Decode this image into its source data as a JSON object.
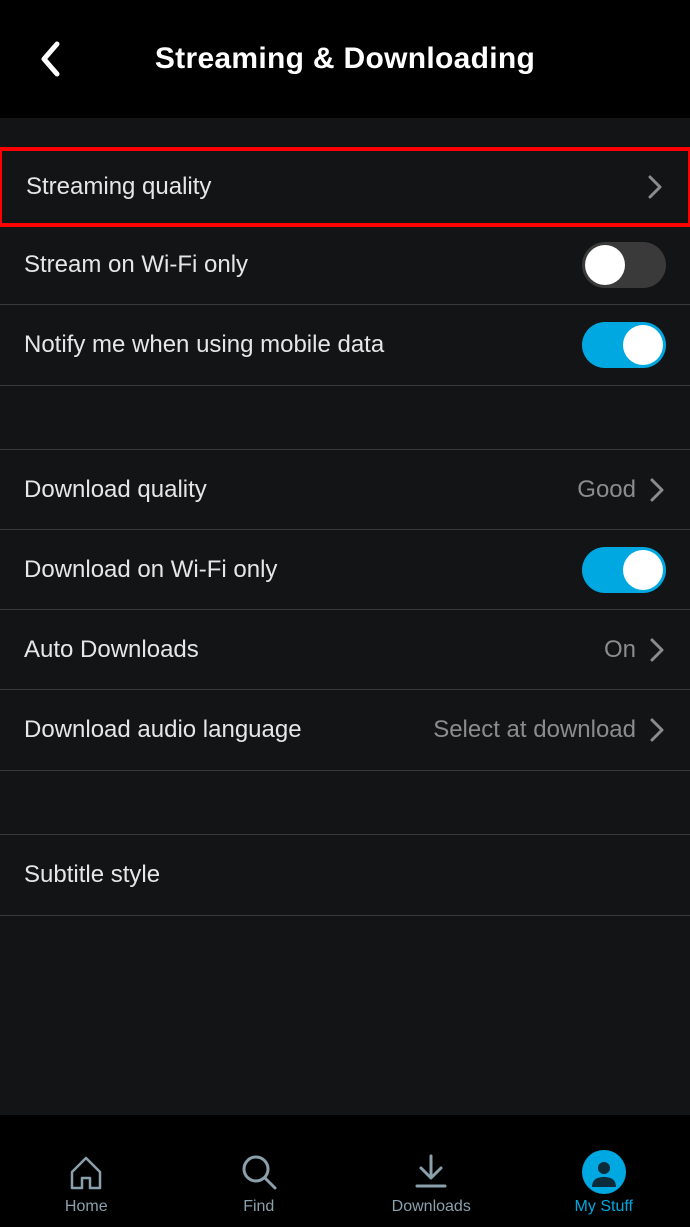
{
  "header": {
    "title": "Streaming & Downloading"
  },
  "sections": {
    "streaming": {
      "quality": {
        "label": "Streaming quality"
      },
      "wifi_only": {
        "label": "Stream on Wi-Fi only",
        "enabled": false
      },
      "mobile_notify": {
        "label": "Notify me when using mobile data",
        "enabled": true
      }
    },
    "downloading": {
      "quality": {
        "label": "Download quality",
        "value": "Good"
      },
      "wifi_only": {
        "label": "Download on Wi-Fi only",
        "enabled": true
      },
      "auto": {
        "label": "Auto Downloads",
        "value": "On"
      },
      "audio_lang": {
        "label": "Download audio language",
        "value": "Select at download"
      }
    },
    "subtitles": {
      "style": {
        "label": "Subtitle style"
      }
    }
  },
  "tabs": {
    "home": "Home",
    "find": "Find",
    "downloads": "Downloads",
    "mystuff": "My Stuff"
  }
}
